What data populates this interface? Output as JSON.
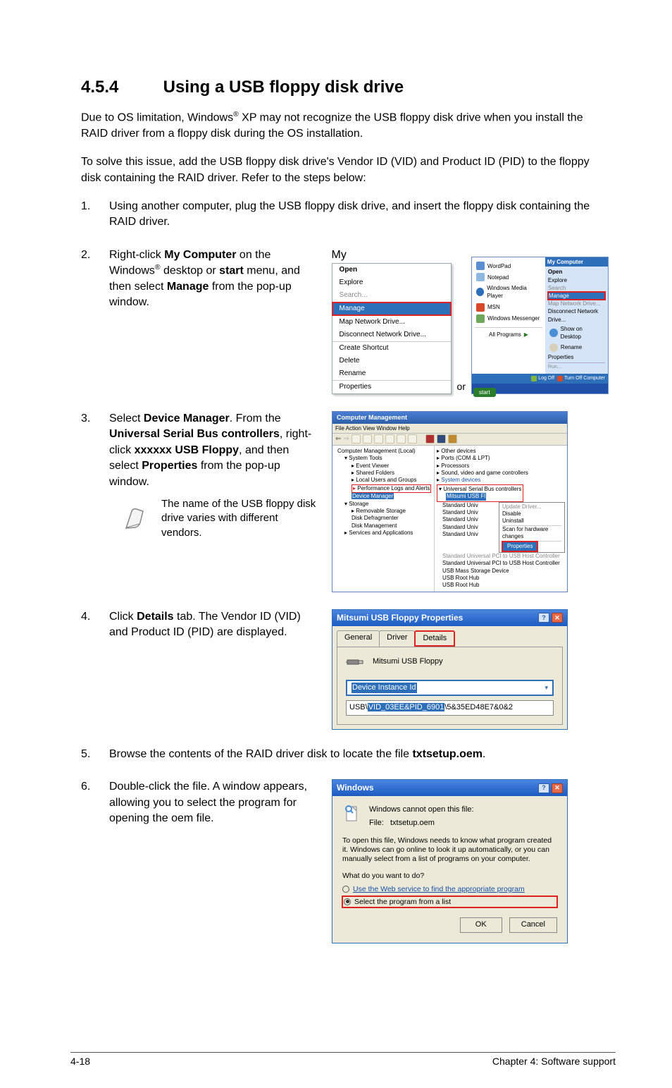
{
  "section": {
    "number": "4.5.4",
    "title": "Using a USB floppy disk drive"
  },
  "intro_html": "Due to OS limitation, Windows<sup>®</sup> XP may not recognize the USB floppy disk drive when you install the RAID driver from a floppy disk during the OS installation.",
  "intro2": "To solve this issue, add the USB floppy disk drive's Vendor ID (VID) and Product ID (PID) to the floppy disk containing the RAID driver. Refer to the steps below:",
  "step1": "Using another computer, plug the USB floppy disk drive, and insert the floppy disk containing the RAID driver.",
  "step2_html": "Right-click <b>My Computer</b> on the Windows<sup>®</sup> desktop or <b>start</b> menu, and then select <b>Manage</b> from the pop-up window.",
  "step2_or": "or",
  "step2_ctx": {
    "mycomp": "My ",
    "open": "Open",
    "explore": "Explore",
    "search": "Search...",
    "manage": "Manage",
    "map": "Map Network Drive...",
    "disc": "Disconnect Network Drive...",
    "create": "Create Shortcut",
    "delete": "Delete",
    "rename": "Rename",
    "props": "Properties"
  },
  "step2_start": {
    "wordpad": "WordPad",
    "notepad": "Notepad",
    "wmp": "Windows Media Player",
    "msn": "MSN",
    "wm": "Windows Messenger",
    "all": "All Programs",
    "mycomp": "My Computer",
    "open": "Open",
    "explore": "Explore",
    "search": "Search",
    "manage": "Manage",
    "map": "Map Network Drive...",
    "disc": "Disconnect Network Drive...",
    "show": "Show on Desktop",
    "rename": "Rename",
    "props": "Properties",
    "logoff": "Log Off",
    "turnoff": "Turn Off Computer",
    "start": "start"
  },
  "step3_html": "Select <b>Device Manager</b>. From the <b>Universal Serial Bus controllers</b>, right-click <b>xxxxxx USB Floppy</b>, and then select <b>Properties</b> from the pop-up window.",
  "note3": "The name of the USB floppy disk drive varies with different vendors.",
  "cm": {
    "title": "Computer Management",
    "menu": "File    Action    View    Window    Help",
    "tree": {
      "root": "Computer Management (Local)",
      "systools": "System Tools",
      "ev": "Event Viewer",
      "sf": "Shared Folders",
      "lug": "Local Users and Groups",
      "perf": "Performance Logs and Alerts",
      "dm": "Device Manager",
      "storage": "Storage",
      "rs": "Removable Storage",
      "dd": "Disk Defragmenter",
      "dmg": "Disk Management",
      "svc": "Services and Applications"
    },
    "right": {
      "other": "Other devices",
      "ports": "Ports (COM & LPT)",
      "proc": "Processors",
      "sound": "Sound, video and game controllers",
      "sysdev": "System devices",
      "usb": "Universal Serial Bus controllers",
      "mitsumi": "Mitsumi USB Fl",
      "update": "Update Driver...",
      "disable": "Disable",
      "uninstall": "Uninstall",
      "scan": "Scan for hardware changes",
      "properties": "Properties",
      "std": "Standard Univ",
      "stdfull": "Standard Universal PCI to USB Host Controller",
      "stdpci": "Standard Universal PCI to USB Host Controller",
      "mass": "USB Mass Storage Device",
      "root": "USB Root Hub",
      "root2": "USB Root Hub"
    }
  },
  "step4_html": "Click <b>Details</b> tab. The Vendor ID (VID) and Product ID (PID) are displayed.",
  "prop": {
    "title": "Mitsumi USB Floppy Properties",
    "tab_general": "General",
    "tab_driver": "Driver",
    "tab_details": "Details",
    "name": "Mitsumi USB Floppy",
    "field": "Device Instance Id",
    "prefix": "USB\\",
    "code_blue": "VID_03EE&PID_6901",
    "code_rest": "\\5&35ED48E7&0&2"
  },
  "step5_html": "Browse the contents of the RAID driver disk to locate the file <b>txtsetup.oem</b>.",
  "step6": "Double-click the file. A window appears, allowing you to select the program for opening the oem file.",
  "windlg": {
    "title": "Windows",
    "cannot": "Windows cannot open this file:",
    "file_label": "File:",
    "file_name": "txtsetup.oem",
    "desc": "To open this file, Windows needs to know what program created it. Windows can go online to look it up automatically, or you can manually select from a list of programs on your computer.",
    "what": "What do you want to do?",
    "r1": "Use the Web service to find the appropriate program",
    "r2": "Select the program from a list",
    "ok": "OK",
    "cancel": "Cancel"
  },
  "footer": {
    "left": "4-18",
    "right": "Chapter 4: Software support"
  }
}
